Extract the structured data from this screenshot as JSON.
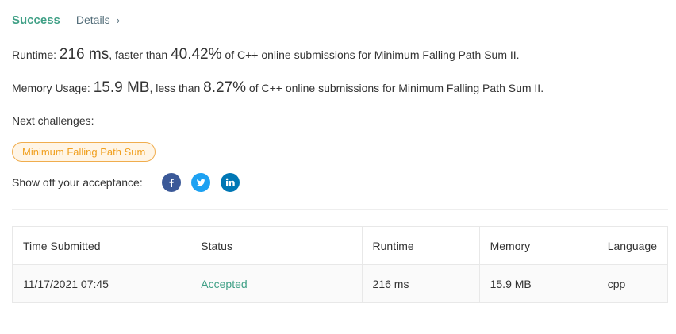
{
  "header": {
    "status": "Success",
    "details_label": "Details"
  },
  "runtime_line": {
    "label": "Runtime: ",
    "value": "216 ms",
    "mid": ", faster than ",
    "percent": "40.42%",
    "suffix": " of C++ online submissions for Minimum Falling Path Sum II."
  },
  "memory_line": {
    "label": "Memory Usage: ",
    "value": "15.9 MB",
    "mid": ", less than ",
    "percent": "8.27%",
    "suffix": " of C++ online submissions for Minimum Falling Path Sum II."
  },
  "next_challenges": {
    "label": "Next challenges:",
    "items": [
      "Minimum Falling Path Sum"
    ]
  },
  "share": {
    "label": "Show off your acceptance:"
  },
  "table": {
    "headers": [
      "Time Submitted",
      "Status",
      "Runtime",
      "Memory",
      "Language"
    ],
    "rows": [
      {
        "time": "11/17/2021 07:45",
        "status": "Accepted",
        "runtime": "216 ms",
        "memory": "15.9 MB",
        "language": "cpp"
      }
    ]
  },
  "colors": {
    "accent": "#40a086",
    "chip_border": "#f0ad4e",
    "chip_text": "#f0a020",
    "facebook": "#3b5998",
    "twitter": "#1da1f2",
    "linkedin": "#0077b5"
  },
  "icons": {
    "details": "chevron-right-icon",
    "facebook": "facebook-icon",
    "twitter": "twitter-icon",
    "linkedin": "linkedin-icon"
  }
}
